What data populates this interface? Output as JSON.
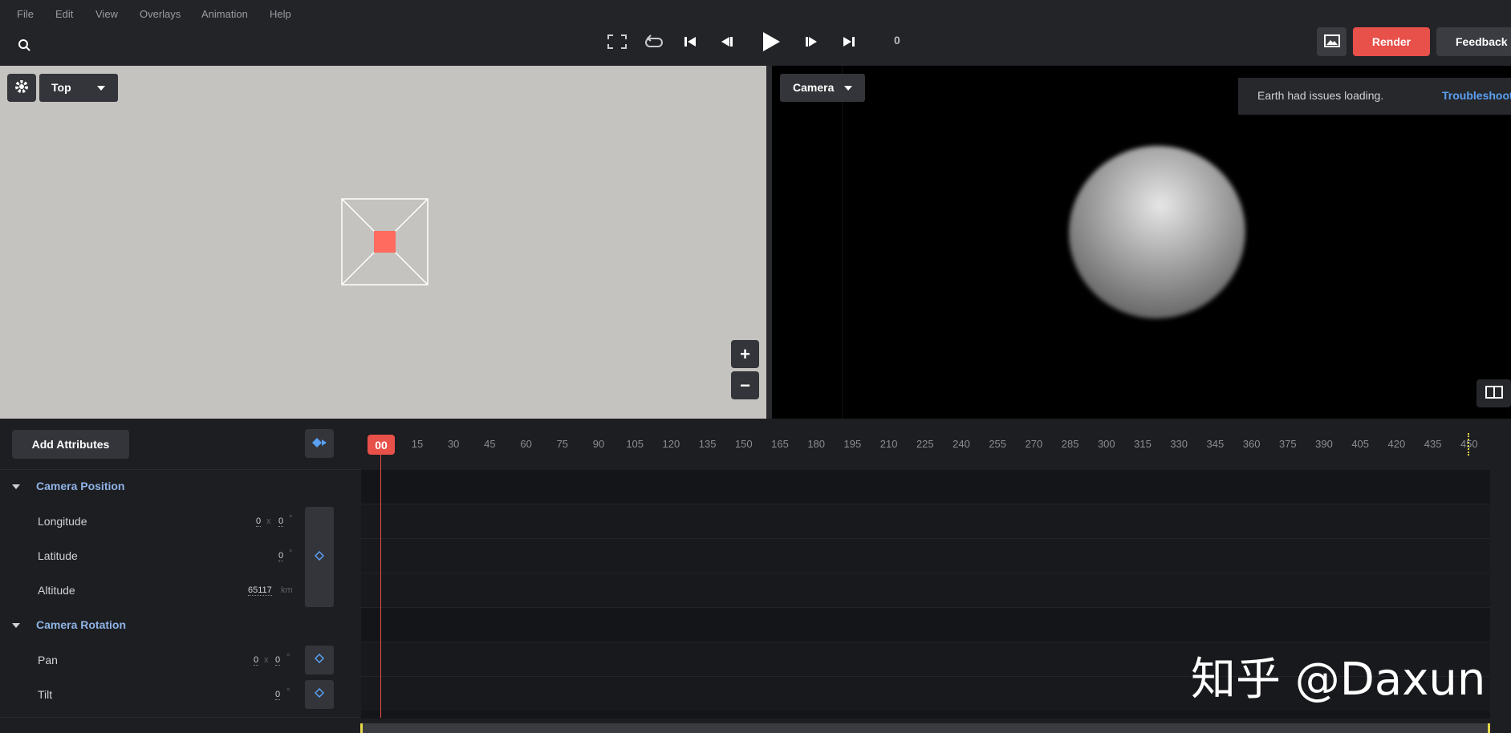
{
  "menu": [
    "File",
    "Edit",
    "View",
    "Overlays",
    "Animation",
    "Help"
  ],
  "transport": {
    "frame": "0"
  },
  "actions": {
    "render": "Render",
    "feedback": "Feedback"
  },
  "left_view": {
    "dropdown": "Top"
  },
  "right_view": {
    "dropdown": "Camera"
  },
  "notice": {
    "message": "Earth had issues loading.",
    "link": "Troubleshoot"
  },
  "zoom": {
    "plus": "+",
    "minus": "−"
  },
  "timeline": {
    "add_attributes": "Add Attributes",
    "current": "00",
    "ticks": [
      "15",
      "30",
      "45",
      "60",
      "75",
      "90",
      "105",
      "120",
      "135",
      "150",
      "165",
      "180",
      "195",
      "210",
      "225",
      "240",
      "255",
      "270",
      "285",
      "300",
      "315",
      "330",
      "345",
      "360",
      "375",
      "390",
      "405",
      "420",
      "435",
      "450"
    ]
  },
  "attributes": {
    "position_group": "Camera Position",
    "longitude": {
      "label": "Longitude",
      "v1": "0",
      "sep": "x",
      "v2": "0",
      "unit": "°"
    },
    "latitude": {
      "label": "Latitude",
      "v1": "0",
      "unit": "°"
    },
    "altitude": {
      "label": "Altitude",
      "v1": "65117",
      "unit": "km"
    },
    "rotation_group": "Camera Rotation",
    "pan": {
      "label": "Pan",
      "v1": "0",
      "sep": "x",
      "v2": "0",
      "unit": "°"
    },
    "tilt": {
      "label": "Tilt",
      "v1": "0",
      "unit": "°"
    }
  },
  "watermark": "知乎 @Daxun",
  "colors": {
    "accent_red": "#e8504a",
    "link_blue": "#5aa0f2",
    "selection": "#ff6b5e"
  }
}
